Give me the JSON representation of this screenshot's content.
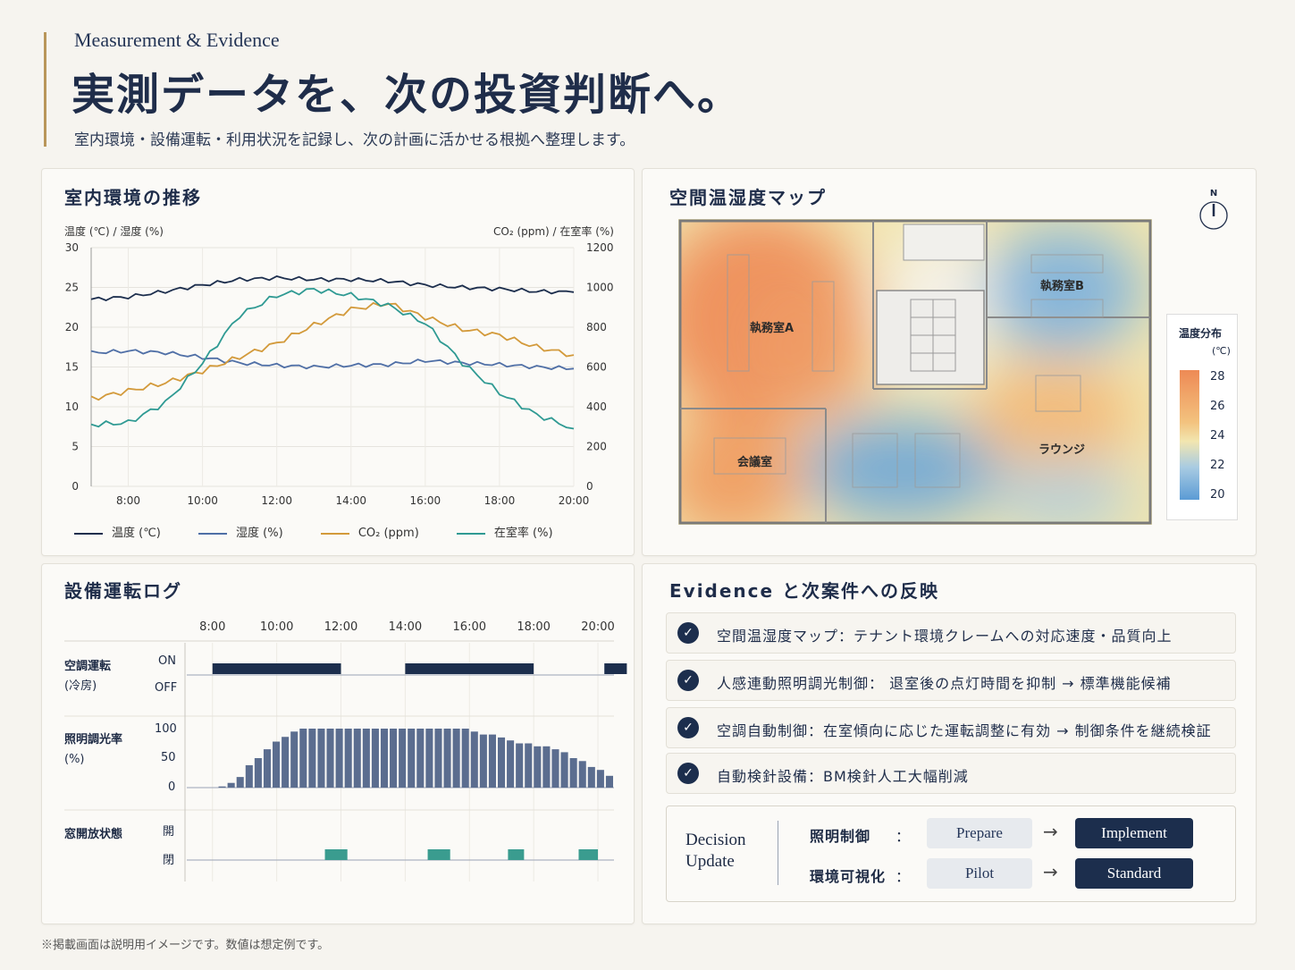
{
  "header": {
    "eyebrow": "Measurement & Evidence",
    "title": "実測データを、次の投資判断へ。",
    "description": "室内環境・設備運転・利用状況を記録し、次の計画に活かせる根拠へ整理します。"
  },
  "env_panel": {
    "title": "室内環境の推移",
    "left_axis_label": "温度 (℃) / 湿度 (%)",
    "right_axis_label": "CO₂ (ppm) / 在室率 (%)"
  },
  "chart_data": {
    "type": "line",
    "title": "室内環境の推移",
    "xlabel": "",
    "ylabel": "温度 (℃) / 湿度 (%)",
    "y2label": "CO₂ (ppm) / 在室率 (%)",
    "x_ticks": [
      "8:00",
      "10:00",
      "12:00",
      "14:00",
      "16:00",
      "18:00",
      "20:00"
    ],
    "xlim": [
      7.0,
      20.0
    ],
    "ylim": [
      0,
      30
    ],
    "y_ticks": [
      0,
      5,
      10,
      15,
      20,
      25,
      30
    ],
    "y2lim": [
      0,
      1200
    ],
    "y2_ticks": [
      0,
      200,
      400,
      600,
      800,
      1000,
      1200
    ],
    "grid": true,
    "legend_position": "bottom",
    "x": [
      7,
      8,
      9,
      10,
      11,
      12,
      13,
      14,
      15,
      16,
      17,
      18,
      19,
      20
    ],
    "series": [
      {
        "name": "温度 (℃)",
        "axis": "left",
        "color": "#1c2e4d",
        "values": [
          23.5,
          23.8,
          24.5,
          25.3,
          26.0,
          26.2,
          26.0,
          26.0,
          25.8,
          25.3,
          25.0,
          24.8,
          24.5,
          24.4
        ]
      },
      {
        "name": "湿度 (%)",
        "axis": "left",
        "color": "#4f6fa6",
        "values": [
          16.8,
          17.0,
          16.8,
          16.2,
          15.5,
          15.2,
          15.0,
          15.2,
          15.3,
          15.8,
          15.5,
          15.3,
          15.0,
          14.8
        ]
      },
      {
        "name": "CO₂ (ppm)",
        "axis": "right",
        "color": "#d39a3b",
        "values": [
          440,
          480,
          520,
          580,
          650,
          720,
          810,
          890,
          920,
          850,
          790,
          760,
          700,
          660
        ]
      },
      {
        "name": "在室率 (%)",
        "axis": "right",
        "color": "#2f9a93",
        "values": [
          310,
          320,
          420,
          620,
          860,
          960,
          990,
          960,
          910,
          820,
          620,
          470,
          360,
          290
        ]
      }
    ]
  },
  "map_panel": {
    "title": "空間温湿度マップ",
    "compass": "N",
    "rooms": {
      "office_a": "執務室A",
      "office_b": "執務室B",
      "meeting": "会議室",
      "lounge": "ラウンジ"
    },
    "legend": {
      "title": "温度分布",
      "unit": "(℃)",
      "ticks": [
        "28",
        "26",
        "24",
        "22",
        "20"
      ]
    },
    "colors": {
      "hot": "#ee8a55",
      "warm": "#f3c27e",
      "neutral": "#f2e6b0",
      "cool": "#a8cbe2",
      "cold": "#6fa6d6"
    }
  },
  "log_panel": {
    "title": "設備運転ログ",
    "time_ticks": [
      "8:00",
      "10:00",
      "12:00",
      "14:00",
      "16:00",
      "18:00",
      "20:00"
    ],
    "hvac": {
      "label_line1": "空調運転",
      "label_line2": "(冷房)",
      "on": "ON",
      "off": "OFF",
      "on_periods": [
        [
          8.0,
          12.0
        ],
        [
          14.0,
          18.0
        ],
        [
          20.2,
          20.9
        ]
      ]
    },
    "lighting": {
      "label_line1": "照明調光率",
      "label_line2": "(%)",
      "ticks": [
        "100",
        "50",
        "0"
      ],
      "values": [
        0,
        0,
        2,
        8,
        18,
        38,
        50,
        65,
        78,
        86,
        95,
        100,
        100,
        100,
        100,
        100,
        100,
        100,
        100,
        100,
        100,
        100,
        100,
        100,
        100,
        100,
        100,
        100,
        100,
        100,
        95,
        90,
        90,
        85,
        80,
        75,
        75,
        70,
        70,
        65,
        60,
        50,
        45,
        35,
        30,
        20
      ]
    },
    "window": {
      "label": "窓開放状態",
      "open": "開",
      "closed": "閉",
      "open_periods": [
        [
          11.5,
          12.2
        ],
        [
          14.7,
          15.4
        ],
        [
          17.2,
          17.7
        ],
        [
          19.4,
          20.0
        ]
      ]
    },
    "colors": {
      "hvac": "#1c2e4d",
      "lighting": "#5b6d8f",
      "window": "#3a9c8f"
    }
  },
  "evidence_panel": {
    "title": "Evidence と次案件への反映",
    "items": [
      "空間温湿度マップ：テナント環境クレームへの対応速度・品質向上",
      "人感連動照明調光制御： 退室後の点灯時間を抑制 → 標準機能候補",
      "空調自動制御：在室傾向に応じた運転調整に有効 → 制御条件を継続検証",
      "自動検針設備：BM検針人工大幅削減"
    ],
    "decision": {
      "label_line1": "Decision",
      "label_line2": "Update",
      "rows": [
        {
          "name": "照明制御",
          "sep": "：",
          "from": "Prepare",
          "arrow": "→",
          "to": "Implement"
        },
        {
          "name": "環境可視化",
          "sep": "：",
          "from": "Pilot",
          "arrow": "→",
          "to": "Standard"
        }
      ]
    }
  },
  "footer": "※掲載画面は説明用イメージです。数値は想定例です。"
}
